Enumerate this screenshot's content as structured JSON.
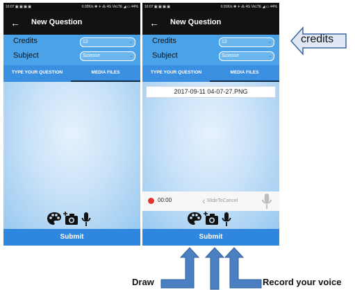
{
  "left_phone": {
    "status_left": "16:07 ▣ ▣ ▣ ▣",
    "status_right": "0.02K/s ✱ ✈ ⁂ 4G VoLTE ◢ ▭ 44%",
    "title": "New Question",
    "credits_label": "Credits",
    "credits_value": "12",
    "subject_label": "Subject",
    "subject_value": "Science",
    "tab_question": "TYPE YOUR QUESTION",
    "tab_media": "MEDIA FILES",
    "active_tab": "TYPE YOUR QUESTION",
    "submit": "Submit"
  },
  "right_phone": {
    "status_left": "16:07 ▣ ▣ ▣ ▣",
    "status_right": "0.91K/s ✱ ✈ ⁂ 4G VoLTE ◢ ▭ 44%",
    "title": "New Question",
    "credits_label": "Credits",
    "credits_value": "12",
    "subject_label": "Subject",
    "subject_value": "Science",
    "tab_question": "TYPE YOUR QUESTION",
    "tab_media": "MEDIA FILES",
    "active_tab": "MEDIA FILES",
    "file_name": "2017-09-11 04-07-27.PNG",
    "rec_time": "00:00",
    "slide_to_cancel": "SlideToCancel",
    "submit": "Submit"
  },
  "annotations": {
    "credits": "credits",
    "draw": "Draw",
    "record_voice": "Record your voice"
  },
  "icons": [
    "back-arrow-icon",
    "palette-icon",
    "add-camera-icon",
    "mic-icon",
    "record-dot-icon",
    "chevron-left-icon",
    "chevron-down-icon"
  ],
  "colors": {
    "primary": "#4aa3e8",
    "tab_bar": "#3b8fe0",
    "submit": "#2e86de",
    "appbar": "#121212",
    "record": "#e2342f",
    "annotation_arrow": "#4a7fc1"
  }
}
